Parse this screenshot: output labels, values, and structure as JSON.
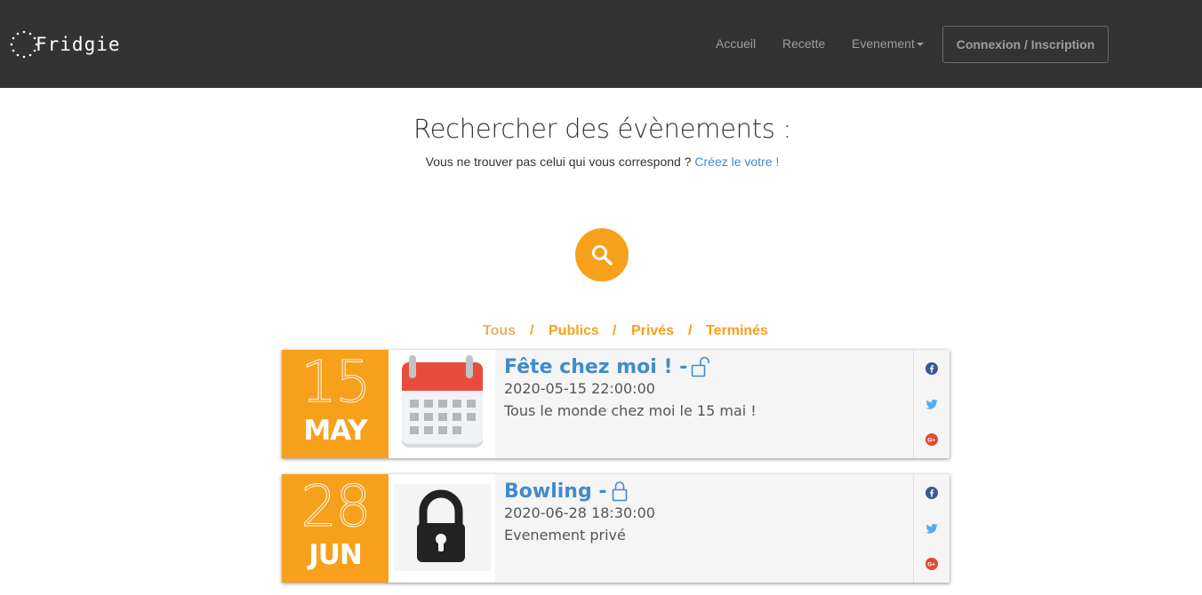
{
  "brand": {
    "name": "Fridgie"
  },
  "nav": {
    "accueil": "Accueil",
    "recette": "Recette",
    "evenement": "Evenement",
    "login": "Connexion / Inscription"
  },
  "header": {
    "title": "Rechercher des évènements :",
    "subtitle": "Vous ne trouver pas celui qui vous correspond ?",
    "create_link": "Créez le votre !"
  },
  "filters": {
    "tous": "Tous",
    "publics": "Publics",
    "prives": "Privés",
    "termines": "Terminés",
    "separator": "/"
  },
  "events": [
    {
      "day": "15",
      "month": "MAY",
      "title": "Fête chez moi ! -",
      "datetime": "2020-05-15 22:00:00",
      "description": "Tous le monde chez moi le 15 mai !",
      "visibility": "public",
      "image": "calendar-icon"
    },
    {
      "day": "28",
      "month": "JUN",
      "title": "Bowling -",
      "datetime": "2020-06-28 18:30:00",
      "description": "Evenement privé",
      "visibility": "private",
      "image": "padlock-icon"
    }
  ],
  "colors": {
    "navbar": "#333333",
    "accent": "#f7a01c",
    "link": "#428bca",
    "facebook": "#3b5998",
    "twitter": "#55acee",
    "google_plus": "#dd4b39"
  }
}
